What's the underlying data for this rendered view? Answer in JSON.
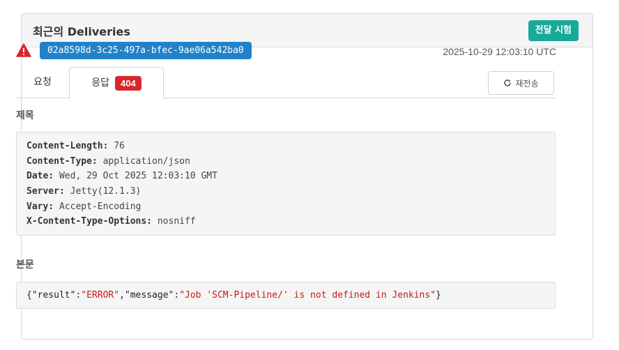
{
  "panel": {
    "title": "최근의 Deliveries",
    "test_button": "전달 시험"
  },
  "delivery": {
    "guid": "02a8598d-3c25-497a-bfec-9ae06a542ba0",
    "timestamp": "2025-10-29 12:03:10 UTC",
    "status_icon": "warning-triangle-icon"
  },
  "tabs": {
    "request": "요청",
    "response": "응답",
    "status_code": "404"
  },
  "redeliver_button": "재전송",
  "headers_label": "제목",
  "headers": [
    {
      "key": "Content-Length:",
      "value": "76"
    },
    {
      "key": "Content-Type:",
      "value": "application/json"
    },
    {
      "key": "Date:",
      "value": "Wed, 29 Oct 2025 12:03:10 GMT"
    },
    {
      "key": "Server:",
      "value": "Jetty(12.1.3)"
    },
    {
      "key": "Vary:",
      "value": "Accept-Encoding"
    },
    {
      "key": "X-Content-Type-Options:",
      "value": "nosniff"
    }
  ],
  "body_label": "본문",
  "body": {
    "open": "{",
    "k1": "\"result\"",
    "colon1": ":",
    "v1": "\"ERROR\"",
    "comma": ",",
    "k2": "\"message\"",
    "colon2": ":",
    "v2": "\"Job 'SCM-Pipeline/' is not defined in Jenkins\"",
    "close": "}"
  },
  "colors": {
    "accent_teal": "#17a99a",
    "guid_blue": "#2182c9",
    "error_red": "#d9262c"
  }
}
